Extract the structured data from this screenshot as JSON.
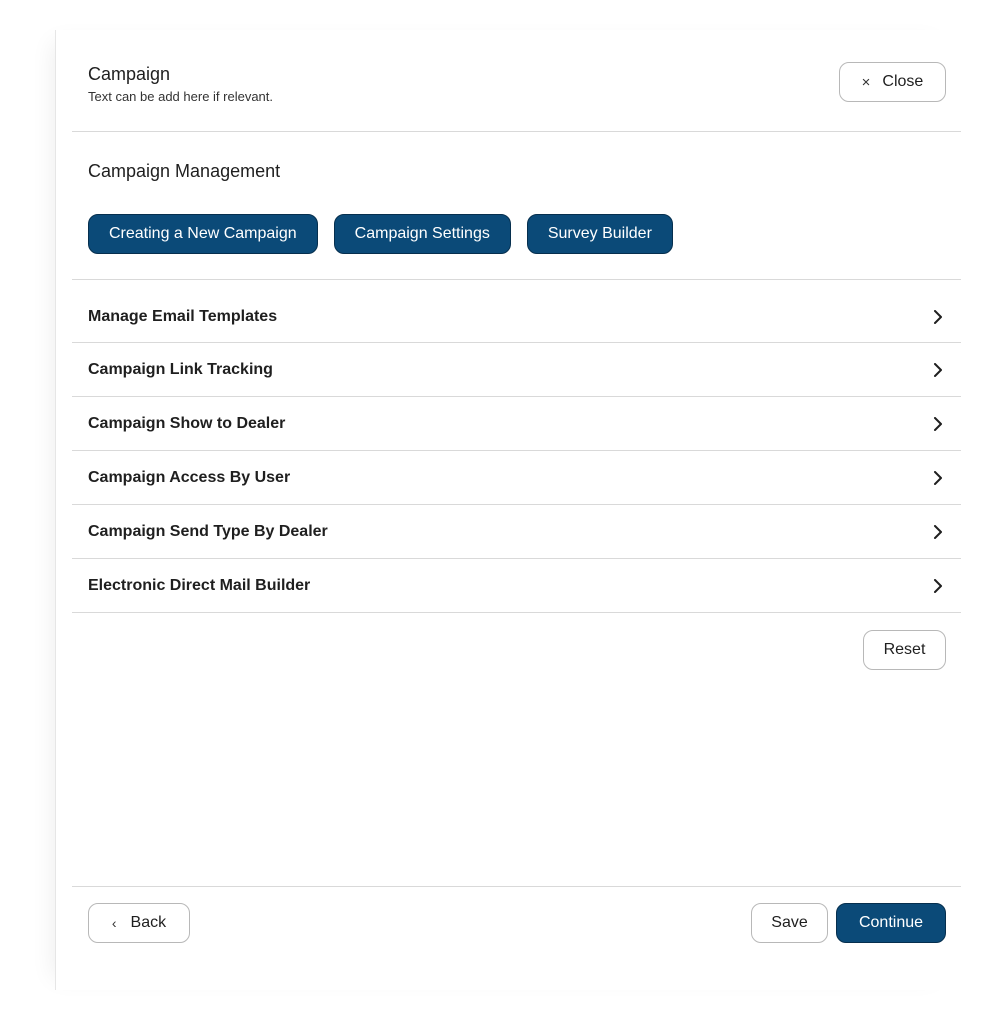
{
  "header": {
    "title": "Campaign",
    "subtitle": "Text can be add here if relevant.",
    "close_icon": "×",
    "close_label": "Close"
  },
  "management": {
    "title": "Campaign Management",
    "chips": [
      {
        "label": "Creating a New Campaign"
      },
      {
        "label": "Campaign Settings"
      },
      {
        "label": "Survey Builder"
      }
    ]
  },
  "list": {
    "items": [
      {
        "label": "Manage Email Templates"
      },
      {
        "label": "Campaign Link Tracking"
      },
      {
        "label": "Campaign Show to Dealer"
      },
      {
        "label": "Campaign Access By User"
      },
      {
        "label": "Campaign Send Type By Dealer"
      },
      {
        "label": "Electronic Direct Mail Builder"
      }
    ]
  },
  "actions": {
    "reset_label": "Reset"
  },
  "footer": {
    "back_icon": "‹",
    "back_label": "Back",
    "save_label": "Save",
    "continue_label": "Continue"
  },
  "colors": {
    "primary": "#0b4a78",
    "border": "#d9d9d9"
  }
}
